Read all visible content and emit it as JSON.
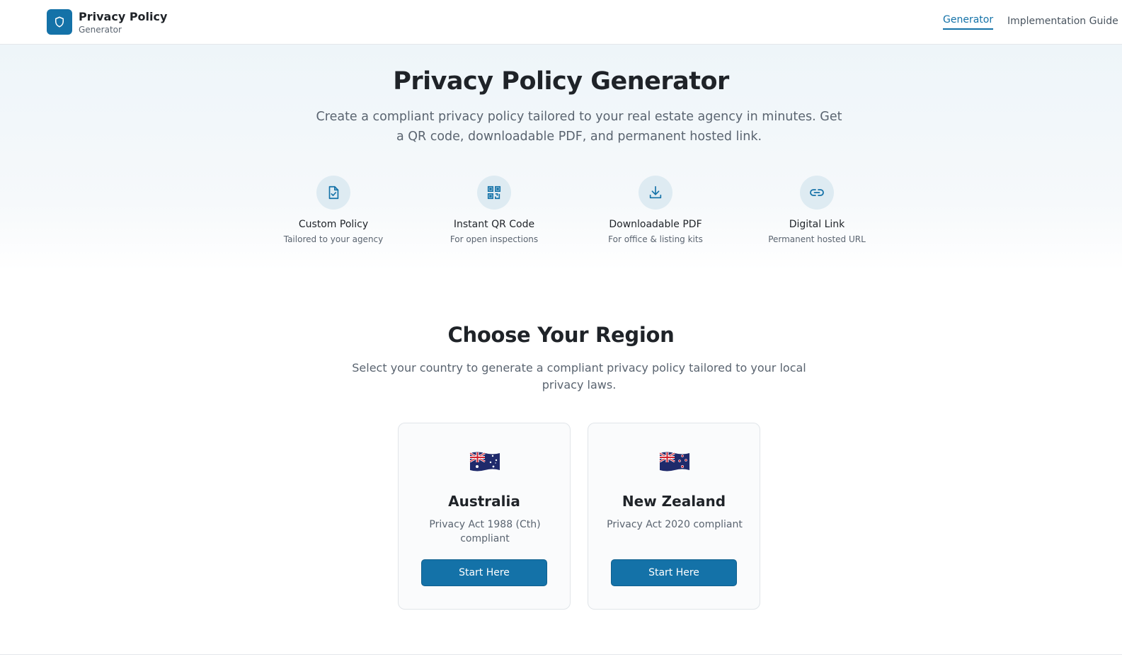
{
  "header": {
    "brand_title": "Privacy Policy",
    "brand_subtitle": "Generator",
    "nav": [
      {
        "label": "Generator",
        "active": true
      },
      {
        "label": "Implementation Guide",
        "active": false
      }
    ],
    "logo_icon": "shield-icon"
  },
  "hero": {
    "title": "Privacy Policy Generator",
    "description": "Create a compliant privacy policy tailored to your real estate agency in minutes. Get a QR code, downloadable PDF, and permanent hosted link.",
    "features": [
      {
        "icon": "document-check-icon",
        "title": "Custom Policy",
        "subtitle": "Tailored to your agency"
      },
      {
        "icon": "qr-code-icon",
        "title": "Instant QR Code",
        "subtitle": "For open inspections"
      },
      {
        "icon": "download-icon",
        "title": "Downloadable PDF",
        "subtitle": "For office & listing kits"
      },
      {
        "icon": "link-icon",
        "title": "Digital Link",
        "subtitle": "Permanent hosted URL"
      }
    ]
  },
  "region": {
    "title": "Choose Your Region",
    "description": "Select your country to generate a compliant privacy policy tailored to your local privacy laws.",
    "cards": [
      {
        "flag": "australia-flag",
        "name": "Australia",
        "law": "Privacy Act 1988 (Cth) compliant",
        "button": "Start Here"
      },
      {
        "flag": "new-zealand-flag",
        "name": "New Zealand",
        "law": "Privacy Act 2020 compliant",
        "button": "Start Here"
      }
    ]
  },
  "colors": {
    "accent": "#1472a8",
    "text": "#1f2328",
    "muted": "#5a6470",
    "icon_bg": "#deebf2"
  }
}
